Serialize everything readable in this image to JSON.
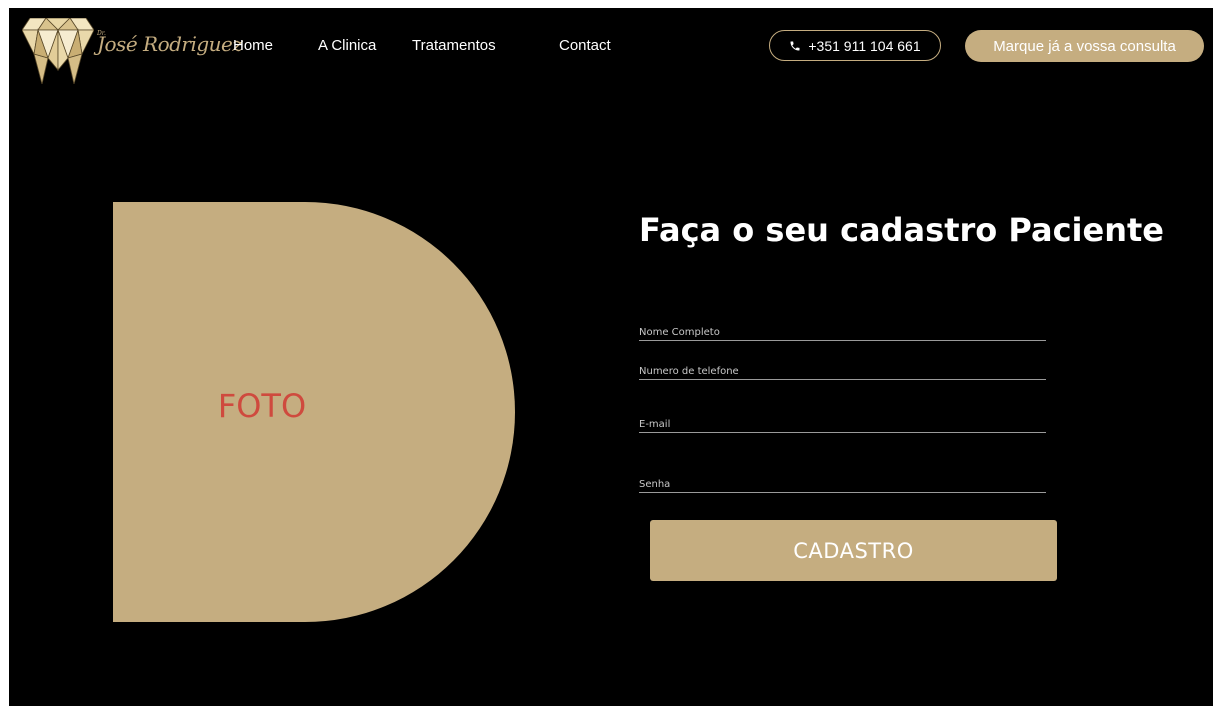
{
  "header": {
    "brand_prefix": "Dr.",
    "brand_name": "José Rodriguez",
    "logo_icon": "diamond-tooth-icon",
    "nav": [
      {
        "label": "Home"
      },
      {
        "label": "A Clinica"
      },
      {
        "label": "Tratamentos"
      },
      {
        "label": "Contact"
      }
    ],
    "phone": {
      "icon": "phone-icon",
      "label": "+351 911  104 661"
    },
    "cta_label": "Marque já a vossa consulta"
  },
  "photo": {
    "label": "FOTO"
  },
  "form": {
    "title": "Faça o seu cadastro Paciente",
    "fields": [
      {
        "placeholder": "Nome Completo"
      },
      {
        "placeholder": "Numero de telefone"
      },
      {
        "placeholder": "E-mail"
      },
      {
        "placeholder": "Senha"
      }
    ],
    "submit_label": "CADASTRO"
  },
  "colors": {
    "background": "#000000",
    "gold": "#c5ad80",
    "photo_label": "#cf4a3e",
    "text": "#ffffff"
  }
}
